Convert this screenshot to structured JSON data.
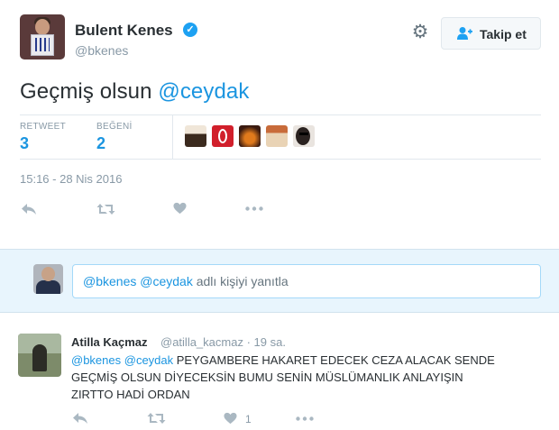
{
  "tweet": {
    "author_name": "Bulent Kenes",
    "author_handle": "@bkenes",
    "verified_icon": "verified-badge-icon",
    "follow_label": "Takip et",
    "text_prefix": "Geçmiş olsun ",
    "text_mention": "@ceydak",
    "stats": {
      "retweet_label": "RETWEET",
      "retweet_count": "3",
      "like_label": "BEĞENİ",
      "like_count": "2"
    },
    "likers": [
      "liker-avatar-1",
      "liker-avatar-2",
      "liker-avatar-3",
      "liker-avatar-4",
      "liker-avatar-5"
    ],
    "timestamp": "15:16 - 28 Nis 2016",
    "actions": [
      "reply-icon",
      "retweet-icon",
      "like-icon",
      "more-icon"
    ]
  },
  "reply_composer": {
    "mention1": "@bkenes",
    "mention2": "@ceydak",
    "rest": " adlı kişiyi yanıtla"
  },
  "reply": {
    "author_name": "Atilla Kaçmaz",
    "author_handle": "@atilla_kacmaz",
    "time": "19 sa.",
    "mention1": "@bkenes",
    "mention2": "@ceydak",
    "line1_rest": " PEYGAMBERE HAKARET EDECEK CEZA ALACAK SENDE",
    "line2": "GEÇMİŞ OLSUN DİYECEKSİN BUMU SENİN MÜSLÜMANLIK ANLAYIŞIN",
    "line3": "ZIRTTO HADİ ORDAN",
    "like_count": "1"
  },
  "colors": {
    "accent": "#1b95e0",
    "muted": "#8899a6",
    "reply_bg": "#e8f5fd"
  }
}
